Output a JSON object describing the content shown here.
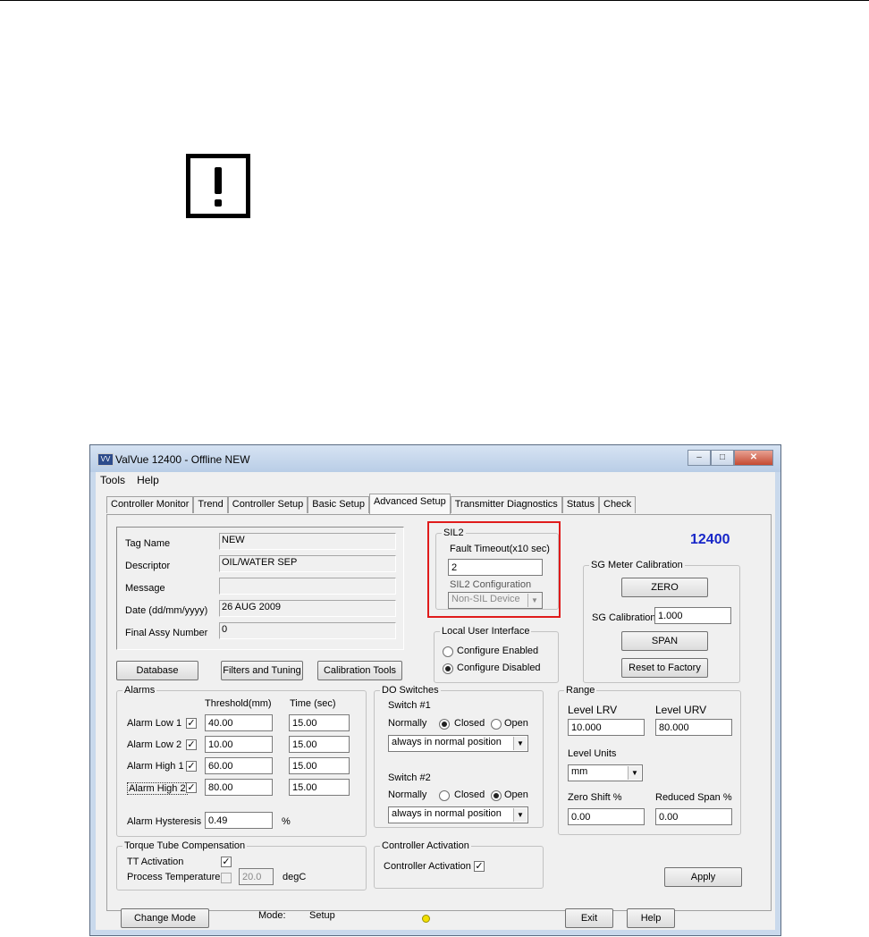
{
  "window": {
    "title": "ValVue 12400 - Offline  NEW",
    "app_icon": "valvue-app-icon",
    "minimize": "–",
    "maximize": "□",
    "close": "✕"
  },
  "menu": [
    "Tools",
    "Help"
  ],
  "tabs": [
    "Controller Monitor",
    "Trend",
    "Controller Setup",
    "Basic Setup",
    "Advanced Setup",
    "Transmitter Diagnostics",
    "Status",
    "Check"
  ],
  "active_tab": "Advanced Setup",
  "model_number": "12400",
  "info": {
    "tag_name_label": "Tag Name",
    "tag_name": "NEW",
    "descriptor_label": "Descriptor",
    "descriptor": "OIL/WATER SEP",
    "message_label": "Message",
    "message": "",
    "date_label": "Date (dd/mm/yyyy)",
    "date": "26 AUG 2009",
    "final_assy_label": "Final Assy Number",
    "final_assy": "0"
  },
  "buttons": {
    "database": "Database",
    "filters": "Filters and Tuning",
    "calibration_tools": "Calibration Tools",
    "zero": "ZERO",
    "span": "SPAN",
    "reset_factory": "Reset to Factory",
    "apply": "Apply",
    "change_mode": "Change Mode",
    "exit": "Exit",
    "help": "Help"
  },
  "sil2": {
    "title": "SIL2",
    "fault_timeout_label": "Fault Timeout(x10 sec)",
    "fault_timeout": "2",
    "config_label": "SIL2 Configuration",
    "config_value": "Non-SIL Device"
  },
  "lui": {
    "title": "Local User Interface",
    "enabled": "Configure Enabled",
    "disabled": "Configure Disabled"
  },
  "sg": {
    "title": "SG Meter Calibration",
    "calibration_label": "SG Calibration",
    "calibration_value": "1.000"
  },
  "alarms": {
    "title": "Alarms",
    "threshold_header": "Threshold(mm)",
    "time_header": "Time (sec)",
    "rows": [
      {
        "label": "Alarm Low 1",
        "checked": "✓",
        "threshold": "40.00",
        "time": "15.00"
      },
      {
        "label": "Alarm Low 2",
        "checked": "✓",
        "threshold": "10.00",
        "time": "15.00"
      },
      {
        "label": "Alarm High 1",
        "checked": "✓",
        "threshold": "60.00",
        "time": "15.00"
      },
      {
        "label": "Alarm High 2",
        "checked": "✓",
        "threshold": "80.00",
        "time": "15.00"
      }
    ],
    "hysteresis_label": "Alarm Hysteresis",
    "hysteresis_value": "0.49",
    "hysteresis_unit": "%"
  },
  "do_switches": {
    "title": "DO Switches",
    "switch1_label": "Switch #1",
    "switch2_label": "Switch #2",
    "normally_label": "Normally",
    "closed_label": "Closed",
    "open_label": "Open",
    "switch1_mode": "always in normal position",
    "switch2_mode": "always in normal position"
  },
  "range": {
    "title": "Range",
    "lrv_label": "Level LRV",
    "lrv": "10.000",
    "urv_label": "Level URV",
    "urv": "80.000",
    "units_label": "Level Units",
    "units": "mm",
    "zero_shift_label": "Zero Shift %",
    "zero_shift": "0.00",
    "reduced_span_label": "Reduced Span %",
    "reduced_span": "0.00"
  },
  "ttc": {
    "title": "Torque Tube Compensation",
    "tt_activation_label": "TT Activation",
    "tt_checked": "✓",
    "process_temp_label": "Process Temperature",
    "process_temp": "20.0",
    "process_temp_unit": "degC"
  },
  "controller_activation": {
    "title": "Controller Activation",
    "label": "Controller Activation",
    "checked": "✓"
  },
  "status_bar": {
    "mode_label": "Mode:",
    "mode_value": "Setup"
  },
  "colors": {
    "model_number": "#1726c8",
    "highlight_box": "#e01b1b",
    "led": "#f2e000"
  }
}
